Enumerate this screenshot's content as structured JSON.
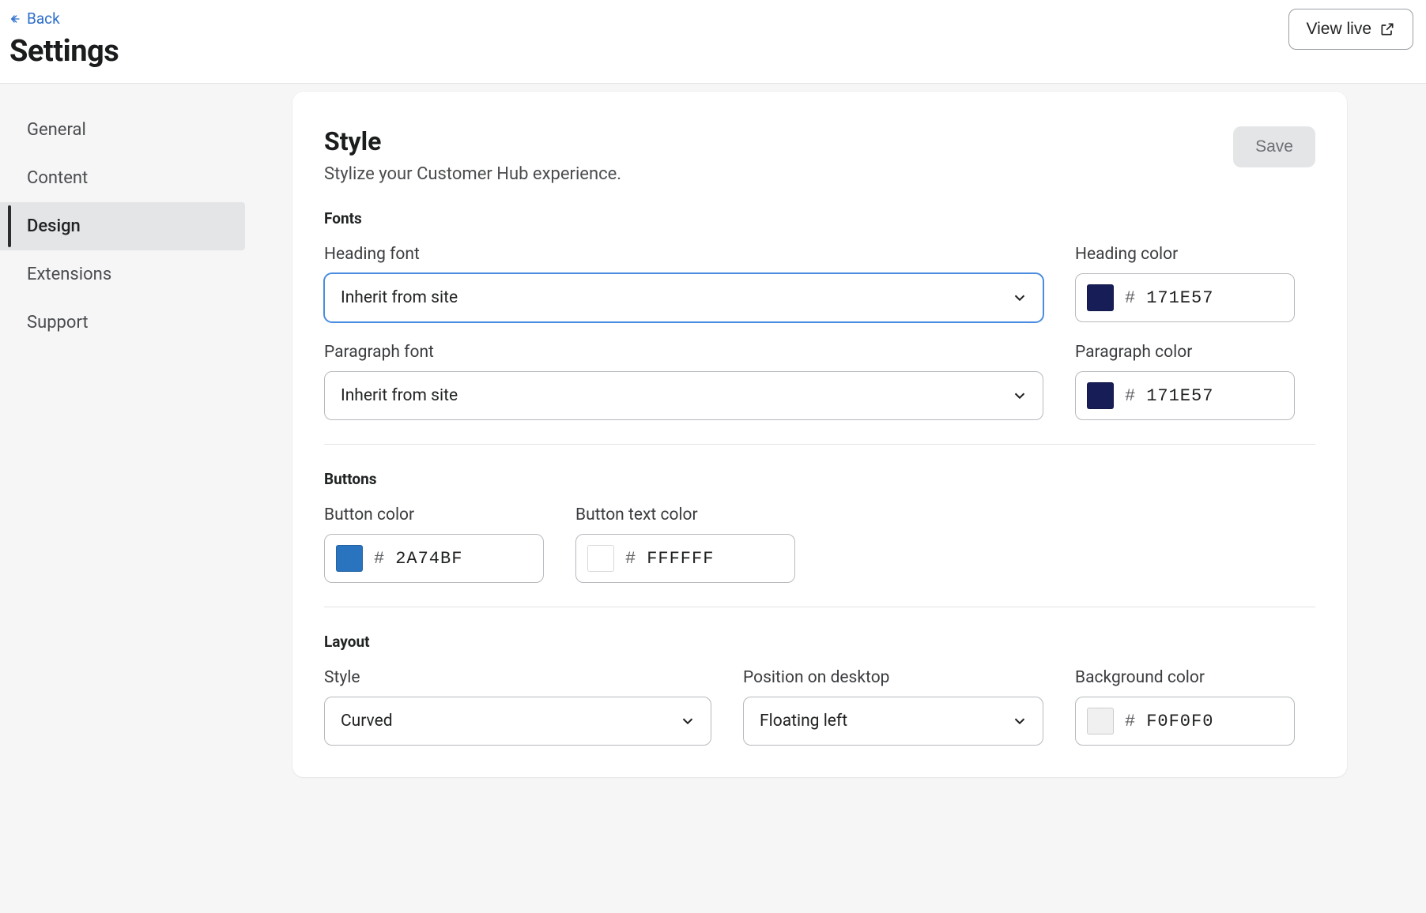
{
  "back_label": "Back",
  "page_title": "Settings",
  "view_live_label": "View live",
  "sidebar": {
    "items": [
      {
        "label": "General",
        "active": false
      },
      {
        "label": "Content",
        "active": false
      },
      {
        "label": "Design",
        "active": true
      },
      {
        "label": "Extensions",
        "active": false
      },
      {
        "label": "Support",
        "active": false
      }
    ]
  },
  "card": {
    "title": "Style",
    "subtitle": "Stylize your Customer Hub experience.",
    "save_label": "Save"
  },
  "sections": {
    "fonts": {
      "title": "Fonts",
      "heading_font_label": "Heading font",
      "heading_font_value": "Inherit from site",
      "heading_color_label": "Heading color",
      "heading_color_hex": "171E57",
      "heading_color_css": "#171E57",
      "paragraph_font_label": "Paragraph font",
      "paragraph_font_value": "Inherit from site",
      "paragraph_color_label": "Paragraph color",
      "paragraph_color_hex": "171E57",
      "paragraph_color_css": "#171E57"
    },
    "buttons": {
      "title": "Buttons",
      "button_color_label": "Button color",
      "button_color_hex": "2A74BF",
      "button_color_css": "#2A74BF",
      "button_text_color_label": "Button text color",
      "button_text_color_hex": "FFFFFF",
      "button_text_color_css": "#FFFFFF"
    },
    "layout": {
      "title": "Layout",
      "style_label": "Style",
      "style_value": "Curved",
      "position_label": "Position on desktop",
      "position_value": "Floating left",
      "bg_color_label": "Background color",
      "bg_color_hex": "F0F0F0",
      "bg_color_css": "#F0F0F0"
    }
  },
  "hash": "#"
}
